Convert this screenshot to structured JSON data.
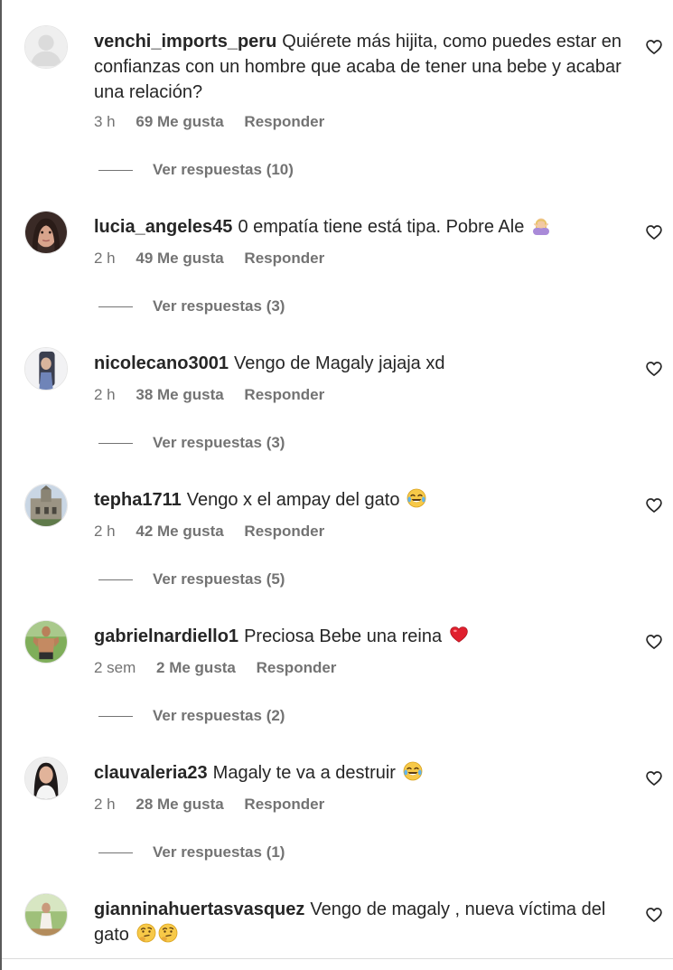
{
  "comments": [
    {
      "username": "venchi_imports_peru",
      "text": "Quiérete más hijita, como puedes estar en confianzas con un hombre que acaba de tener una bebe y acabar una relación?",
      "time": "3 h",
      "likes": "69 Me gusta",
      "reply": "Responder",
      "view_replies": "Ver respuestas (10)",
      "avatar_icon": "default-avatar-icon"
    },
    {
      "username": "lucia_angeles45",
      "text": "0 empatía tiene está tipa. Pobre Ale",
      "emoji": "woman-gesturing-icon",
      "time": "2 h",
      "likes": "49 Me gusta",
      "reply": "Responder",
      "view_replies": "Ver respuestas (3)"
    },
    {
      "username": "nicolecano3001",
      "text": "Vengo de Magaly jajaja xd",
      "time": "2 h",
      "likes": "38 Me gusta",
      "reply": "Responder",
      "view_replies": "Ver respuestas (3)"
    },
    {
      "username": "tepha1711",
      "text": "Vengo x el ampay del gato",
      "emoji": "tears-of-joy-icon",
      "time": "2 h",
      "likes": "42 Me gusta",
      "reply": "Responder",
      "view_replies": "Ver respuestas (5)"
    },
    {
      "username": "gabrielnardiello1",
      "text": "Preciosa Bebe una reina",
      "emoji": "red-heart-icon",
      "time": "2 sem",
      "likes": "2 Me gusta",
      "reply": "Responder",
      "view_replies": "Ver respuestas (2)"
    },
    {
      "username": "clauvaleria23",
      "text": "Magaly te va a destruir",
      "emoji": "tears-of-joy-icon",
      "time": "2 h",
      "likes": "28 Me gusta",
      "reply": "Responder",
      "view_replies": "Ver respuestas (1)"
    },
    {
      "username": "gianninahuertasvasquez",
      "text": "Vengo de magaly , nueva víctima del gato",
      "emoji": "thinking-face-icon",
      "emoji_count": 2
    }
  ],
  "colors": {
    "primary_text": "#262626",
    "secondary_text": "#737373",
    "divider": "#dbdbdb"
  }
}
